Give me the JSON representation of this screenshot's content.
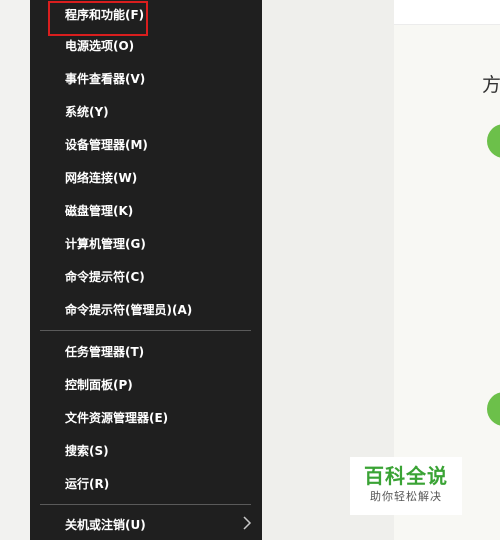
{
  "context_menu": {
    "items_group1": [
      {
        "label": "程序和功能(F)",
        "highlighted": true
      },
      {
        "label": "电源选项(O)"
      },
      {
        "label": "事件查看器(V)"
      },
      {
        "label": "系统(Y)"
      },
      {
        "label": "设备管理器(M)"
      },
      {
        "label": "网络连接(W)"
      },
      {
        "label": "磁盘管理(K)"
      },
      {
        "label": "计算机管理(G)"
      },
      {
        "label": "命令提示符(C)"
      },
      {
        "label": "命令提示符(管理员)(A)"
      }
    ],
    "items_group2": [
      {
        "label": "任务管理器(T)"
      },
      {
        "label": "控制面板(P)"
      },
      {
        "label": "文件资源管理器(E)"
      },
      {
        "label": "搜索(S)"
      },
      {
        "label": "运行(R)"
      }
    ],
    "items_group3": [
      {
        "label": "关机或注销(U)",
        "has_submenu": true,
        "submenu_icon": "chevron-right-icon"
      }
    ],
    "highlight_color": "#d91e1e",
    "background_color": "#1f1f1f"
  },
  "article": {
    "heading_fragment": "方",
    "step_marker_color": "#6cc04a"
  },
  "watermark": {
    "title": "百科全说",
    "subtitle": "助你轻松解决",
    "brand_color": "#3aa335"
  }
}
